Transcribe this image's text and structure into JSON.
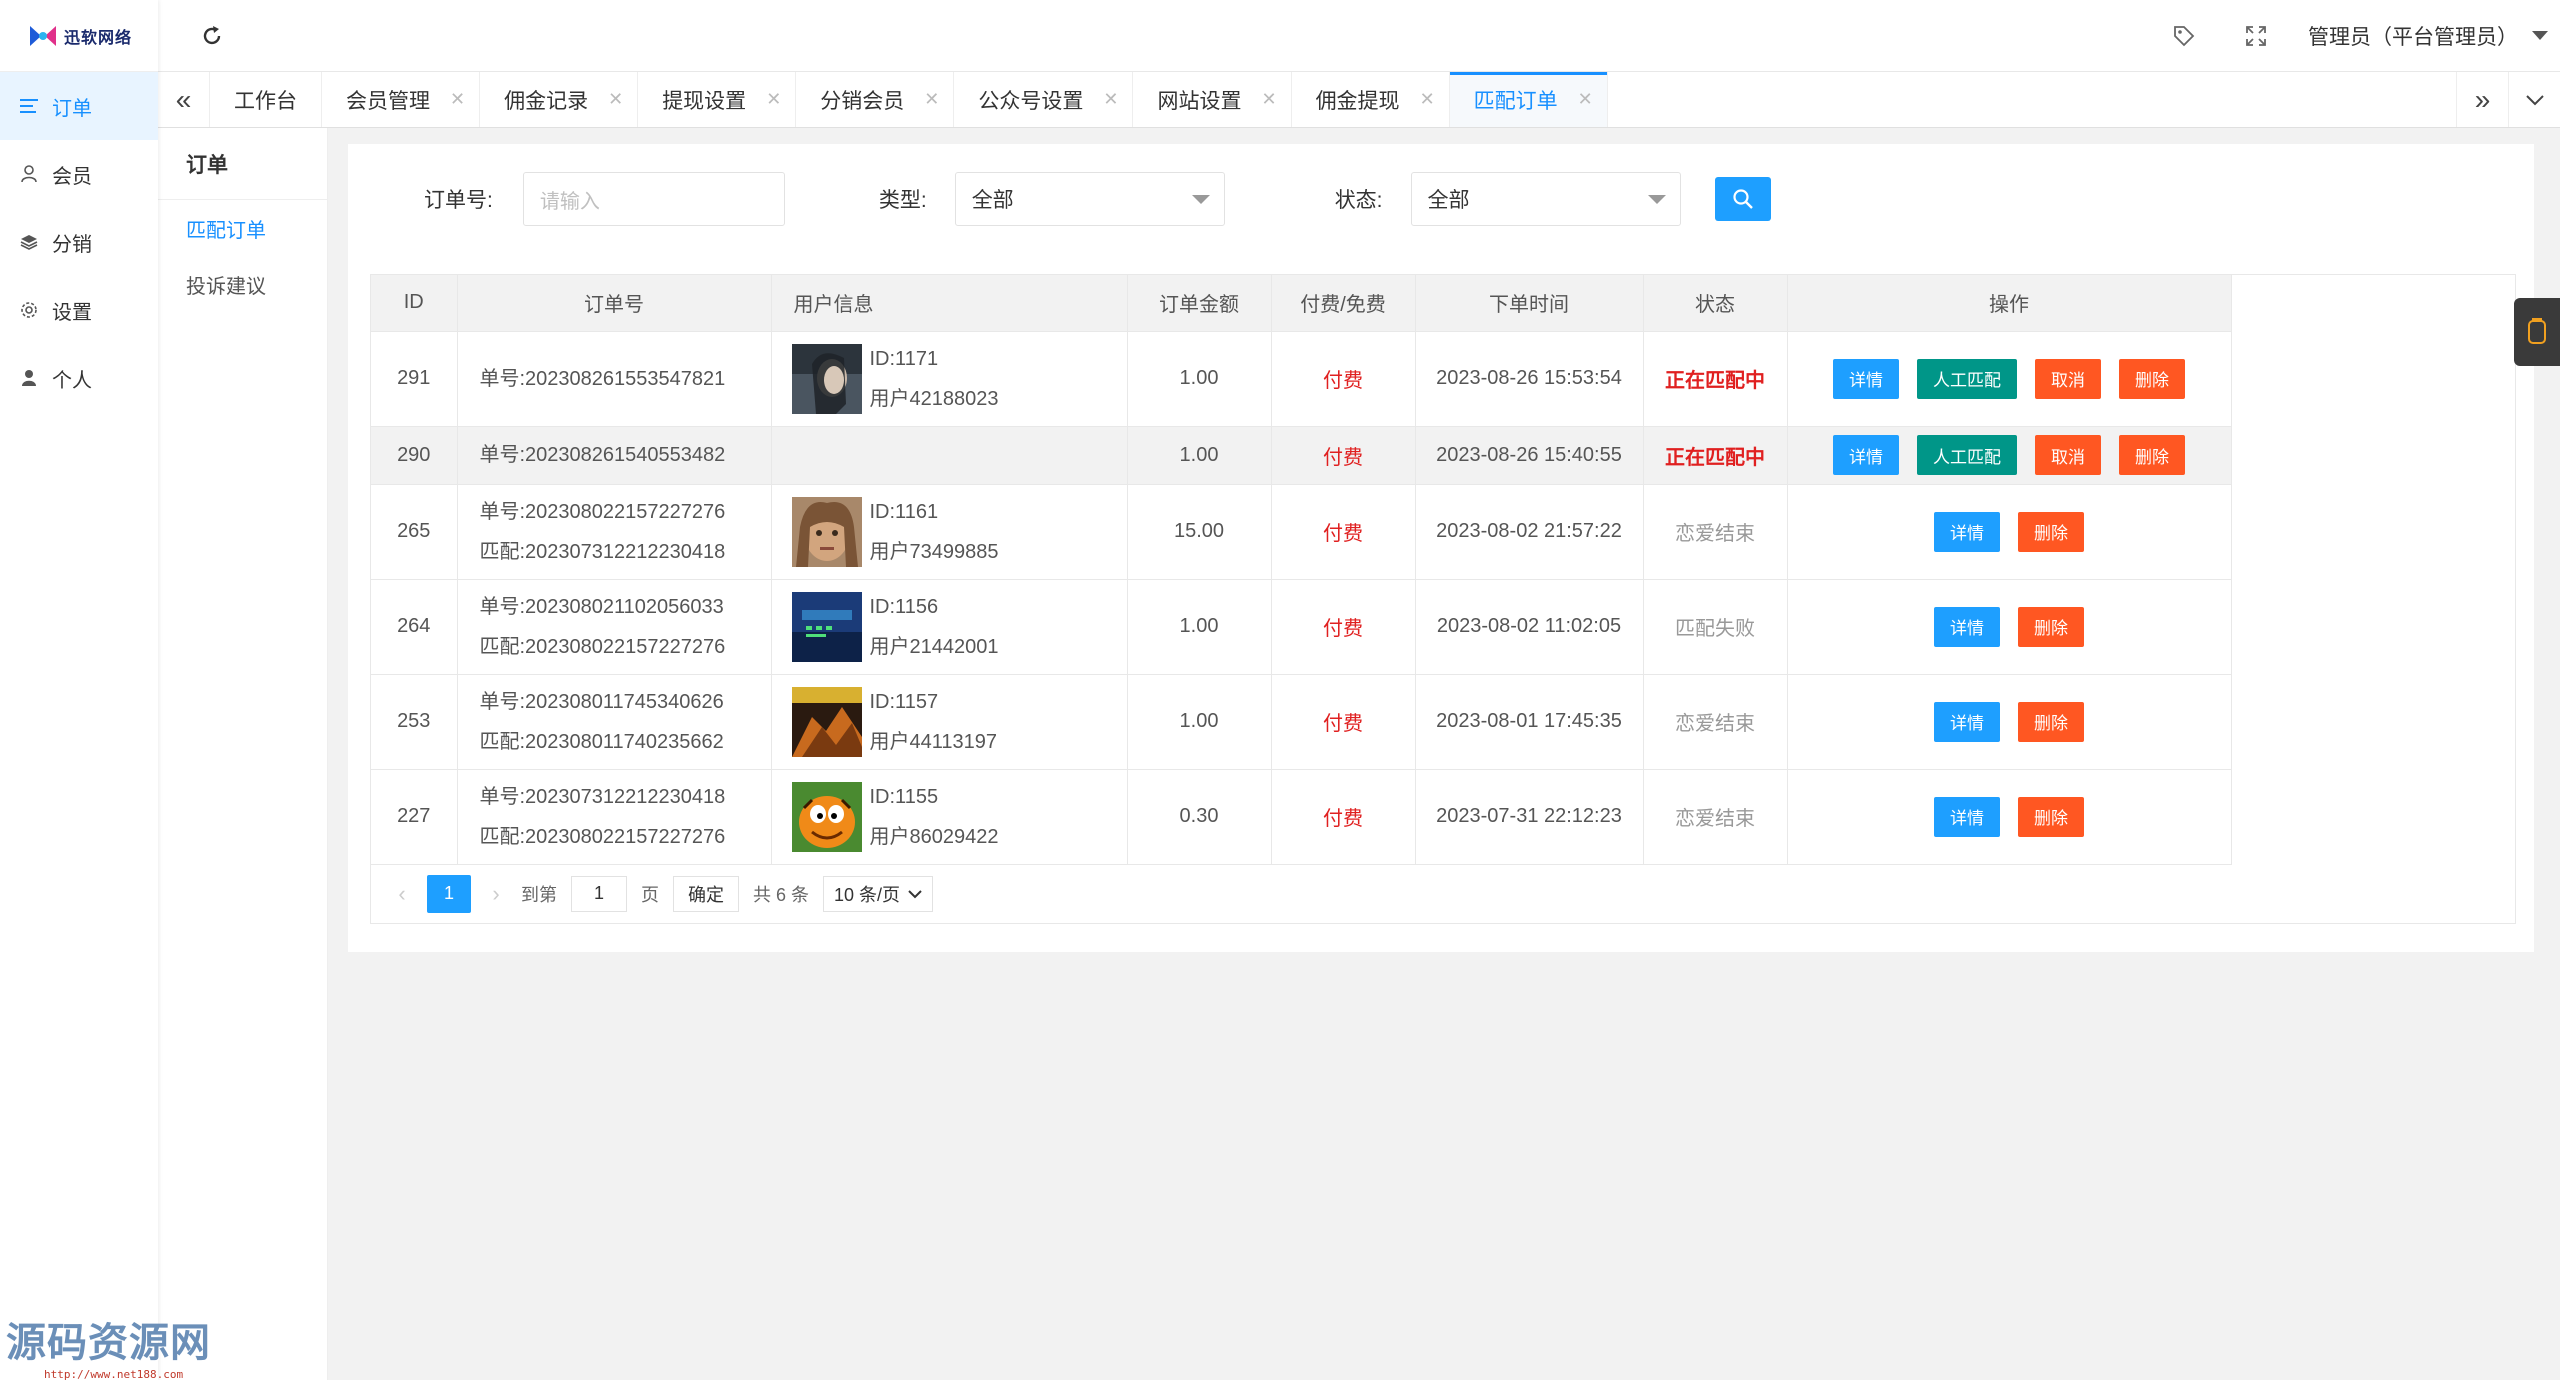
{
  "logo": {
    "text": "迅软网络"
  },
  "sidebar": {
    "items": [
      {
        "label": "订单",
        "icon": "list-icon",
        "active": true
      },
      {
        "label": "会员",
        "icon": "user-icon",
        "active": false
      },
      {
        "label": "分销",
        "icon": "layers-icon",
        "active": false
      },
      {
        "label": "设置",
        "icon": "gear-icon",
        "active": false
      },
      {
        "label": "个人",
        "icon": "person-icon",
        "active": false
      }
    ]
  },
  "header": {
    "admin_label": "管理员（平台管理员）"
  },
  "tabs": [
    {
      "label": "工作台",
      "closable": false
    },
    {
      "label": "会员管理",
      "closable": true
    },
    {
      "label": "佣金记录",
      "closable": true
    },
    {
      "label": "提现设置",
      "closable": true
    },
    {
      "label": "分销会员",
      "closable": true
    },
    {
      "label": "公众号设置",
      "closable": true
    },
    {
      "label": "网站设置",
      "closable": true
    },
    {
      "label": "佣金提现",
      "closable": true
    },
    {
      "label": "匹配订单",
      "closable": true,
      "active": true
    }
  ],
  "submenu": {
    "title": "订单",
    "items": [
      {
        "label": "匹配订单",
        "active": true
      },
      {
        "label": "投诉建议",
        "active": false
      }
    ]
  },
  "filters": {
    "order_label": "订单号:",
    "order_placeholder": "请输入",
    "type_label": "类型:",
    "type_value": "全部",
    "status_label": "状态:",
    "status_value": "全部"
  },
  "table": {
    "headers": [
      "ID",
      "订单号",
      "用户信息",
      "订单金额",
      "付费/免费",
      "下单时间",
      "状态",
      "操作"
    ],
    "rows": [
      {
        "id": "291",
        "order": "单号:202308261553547821",
        "match": "",
        "uid": "ID:1171",
        "uname": "用户42188023",
        "avatar": true,
        "amount": "1.00",
        "pay": "付费",
        "time": "2023-08-26 15:53:54",
        "status": "正在匹配中",
        "status_type": "red",
        "actions": [
          "详情",
          "人工匹配",
          "取消",
          "删除"
        ]
      },
      {
        "id": "290",
        "order": "单号:202308261540553482",
        "match": "",
        "uid": "",
        "uname": "",
        "avatar": false,
        "amount": "1.00",
        "pay": "付费",
        "time": "2023-08-26 15:40:55",
        "status": "正在匹配中",
        "status_type": "red",
        "actions": [
          "详情",
          "人工匹配",
          "取消",
          "删除"
        ]
      },
      {
        "id": "265",
        "order": "单号:202308022157227276",
        "match": "匹配:202307312212230418",
        "uid": "ID:1161",
        "uname": "用户73499885",
        "avatar": true,
        "amount": "15.00",
        "pay": "付费",
        "time": "2023-08-02 21:57:22",
        "status": "恋爱结束",
        "status_type": "grey",
        "actions": [
          "详情",
          "删除"
        ]
      },
      {
        "id": "264",
        "order": "单号:202308021102056033",
        "match": "匹配:202308022157227276",
        "uid": "ID:1156",
        "uname": "用户21442001",
        "avatar": true,
        "amount": "1.00",
        "pay": "付费",
        "time": "2023-08-02 11:02:05",
        "status": "匹配失败",
        "status_type": "grey",
        "actions": [
          "详情",
          "删除"
        ]
      },
      {
        "id": "253",
        "order": "单号:202308011745340626",
        "match": "匹配:202308011740235662",
        "uid": "ID:1157",
        "uname": "用户44113197",
        "avatar": true,
        "amount": "1.00",
        "pay": "付费",
        "time": "2023-08-01 17:45:35",
        "status": "恋爱结束",
        "status_type": "grey",
        "actions": [
          "详情",
          "删除"
        ]
      },
      {
        "id": "227",
        "order": "单号:202307312212230418",
        "match": "匹配:202308022157227276",
        "uid": "ID:1155",
        "uname": "用户86029422",
        "avatar": true,
        "amount": "0.30",
        "pay": "付费",
        "time": "2023-07-31 22:12:23",
        "status": "恋爱结束",
        "status_type": "grey",
        "actions": [
          "详情",
          "删除"
        ]
      }
    ]
  },
  "pager": {
    "current": "1",
    "goto_label": "到第",
    "goto_value": "1",
    "page_unit": "页",
    "confirm": "确定",
    "total": "共 6 条",
    "page_size": "10 条/页"
  },
  "watermark": {
    "big": "源码资源网",
    "small": "http://www.net188.com"
  },
  "colors": {
    "primary": "#1e9fff",
    "green": "#009688",
    "orange": "#ff5722",
    "red": "#e02020",
    "active_nav": "#1890ff"
  }
}
